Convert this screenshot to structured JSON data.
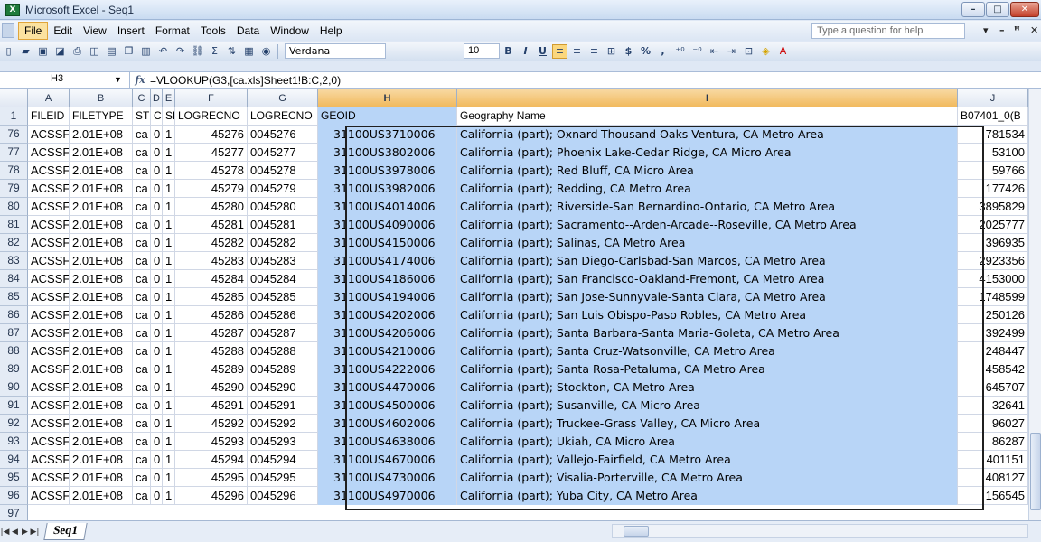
{
  "window": {
    "title": "Microsoft Excel - Seq1",
    "app_icon": "X"
  },
  "window_controls": {
    "minimize": "–",
    "maximize": "□",
    "close": "✕"
  },
  "menu": {
    "items": [
      "File",
      "Edit",
      "View",
      "Insert",
      "Format",
      "Tools",
      "Data",
      "Window",
      "Help"
    ],
    "help_placeholder": "Type a question for help",
    "right_controls": [
      "▾",
      "–",
      "ꟸ",
      "✕"
    ]
  },
  "toolbar": {
    "font_name": "Verdana",
    "font_size": "10",
    "bold": "B",
    "italic": "I",
    "underline": "U",
    "currency": "$",
    "percent": "%",
    "comma": ","
  },
  "formula_bar": {
    "name_box": "H3",
    "fx": "fx",
    "formula": "=VLOOKUP(G3,[ca.xls]Sheet1!B:C,2,0)"
  },
  "columns": [
    "A",
    "B",
    "C",
    "D",
    "E",
    "F",
    "G",
    "H",
    "I",
    "J"
  ],
  "header_row": {
    "row_number": "1",
    "cells": [
      "FILEID",
      "FILETYPE",
      "STU",
      "CI",
      "SE",
      "LOGRECNO",
      "LOGRECNO",
      "GEOID",
      "Geography Name",
      "B07401_0(B"
    ]
  },
  "rows": [
    {
      "n": "76",
      "cells": [
        "ACSSF",
        "2.01E+08",
        "ca",
        "0",
        "1",
        "45276",
        "0045276",
        "31100US3710006",
        "California (part); Oxnard-Thousand Oaks-Ventura, CA Metro Area",
        "781534"
      ]
    },
    {
      "n": "77",
      "cells": [
        "ACSSF",
        "2.01E+08",
        "ca",
        "0",
        "1",
        "45277",
        "0045277",
        "31100US3802006",
        "California (part); Phoenix Lake-Cedar Ridge, CA Micro Area",
        "53100"
      ]
    },
    {
      "n": "78",
      "cells": [
        "ACSSF",
        "2.01E+08",
        "ca",
        "0",
        "1",
        "45278",
        "0045278",
        "31100US3978006",
        "California (part); Red Bluff, CA Micro Area",
        "59766"
      ]
    },
    {
      "n": "79",
      "cells": [
        "ACSSF",
        "2.01E+08",
        "ca",
        "0",
        "1",
        "45279",
        "0045279",
        "31100US3982006",
        "California (part); Redding, CA Metro Area",
        "177426"
      ]
    },
    {
      "n": "80",
      "cells": [
        "ACSSF",
        "2.01E+08",
        "ca",
        "0",
        "1",
        "45280",
        "0045280",
        "31100US4014006",
        "California (part); Riverside-San Bernardino-Ontario, CA Metro Area",
        "3895829"
      ]
    },
    {
      "n": "81",
      "cells": [
        "ACSSF",
        "2.01E+08",
        "ca",
        "0",
        "1",
        "45281",
        "0045281",
        "31100US4090006",
        "California (part); Sacramento--Arden-Arcade--Roseville, CA Metro Area",
        "2025777"
      ]
    },
    {
      "n": "82",
      "cells": [
        "ACSSF",
        "2.01E+08",
        "ca",
        "0",
        "1",
        "45282",
        "0045282",
        "31100US4150006",
        "California (part); Salinas, CA Metro Area",
        "396935"
      ]
    },
    {
      "n": "83",
      "cells": [
        "ACSSF",
        "2.01E+08",
        "ca",
        "0",
        "1",
        "45283",
        "0045283",
        "31100US4174006",
        "California (part); San Diego-Carlsbad-San Marcos, CA Metro Area",
        "2923356"
      ]
    },
    {
      "n": "84",
      "cells": [
        "ACSSF",
        "2.01E+08",
        "ca",
        "0",
        "1",
        "45284",
        "0045284",
        "31100US4186006",
        "California (part); San Francisco-Oakland-Fremont, CA Metro Area",
        "4153000"
      ]
    },
    {
      "n": "85",
      "cells": [
        "ACSSF",
        "2.01E+08",
        "ca",
        "0",
        "1",
        "45285",
        "0045285",
        "31100US4194006",
        "California (part); San Jose-Sunnyvale-Santa Clara, CA Metro Area",
        "1748599"
      ]
    },
    {
      "n": "86",
      "cells": [
        "ACSSF",
        "2.01E+08",
        "ca",
        "0",
        "1",
        "45286",
        "0045286",
        "31100US4202006",
        "California (part); San Luis Obispo-Paso Robles, CA Metro Area",
        "250126"
      ]
    },
    {
      "n": "87",
      "cells": [
        "ACSSF",
        "2.01E+08",
        "ca",
        "0",
        "1",
        "45287",
        "0045287",
        "31100US4206006",
        "California (part); Santa Barbara-Santa Maria-Goleta, CA Metro Area",
        "392499"
      ]
    },
    {
      "n": "88",
      "cells": [
        "ACSSF",
        "2.01E+08",
        "ca",
        "0",
        "1",
        "45288",
        "0045288",
        "31100US4210006",
        "California (part); Santa Cruz-Watsonville, CA Metro Area",
        "248447"
      ]
    },
    {
      "n": "89",
      "cells": [
        "ACSSF",
        "2.01E+08",
        "ca",
        "0",
        "1",
        "45289",
        "0045289",
        "31100US4222006",
        "California (part); Santa Rosa-Petaluma, CA Metro Area",
        "458542"
      ]
    },
    {
      "n": "90",
      "cells": [
        "ACSSF",
        "2.01E+08",
        "ca",
        "0",
        "1",
        "45290",
        "0045290",
        "31100US4470006",
        "California (part); Stockton, CA Metro Area",
        "645707"
      ]
    },
    {
      "n": "91",
      "cells": [
        "ACSSF",
        "2.01E+08",
        "ca",
        "0",
        "1",
        "45291",
        "0045291",
        "31100US4500006",
        "California (part); Susanville, CA Micro Area",
        "32641"
      ]
    },
    {
      "n": "92",
      "cells": [
        "ACSSF",
        "2.01E+08",
        "ca",
        "0",
        "1",
        "45292",
        "0045292",
        "31100US4602006",
        "California (part); Truckee-Grass Valley, CA Micro Area",
        "96027"
      ]
    },
    {
      "n": "93",
      "cells": [
        "ACSSF",
        "2.01E+08",
        "ca",
        "0",
        "1",
        "45293",
        "0045293",
        "31100US4638006",
        "California (part); Ukiah, CA Micro Area",
        "86287"
      ]
    },
    {
      "n": "94",
      "cells": [
        "ACSSF",
        "2.01E+08",
        "ca",
        "0",
        "1",
        "45294",
        "0045294",
        "31100US4670006",
        "California (part); Vallejo-Fairfield, CA Metro Area",
        "401151"
      ]
    },
    {
      "n": "95",
      "cells": [
        "ACSSF",
        "2.01E+08",
        "ca",
        "0",
        "1",
        "45295",
        "0045295",
        "31100US4730006",
        "California (part); Visalia-Porterville, CA Metro Area",
        "408127"
      ]
    },
    {
      "n": "96",
      "cells": [
        "ACSSF",
        "2.01E+08",
        "ca",
        "0",
        "1",
        "45296",
        "0045296",
        "31100US4970006",
        "California (part); Yuba City, CA Metro Area",
        "156545"
      ]
    }
  ],
  "empty_row": "97",
  "sheet_tabs": [
    "Seq1"
  ],
  "colors": {
    "selection": "#b8d5f7",
    "selected_header": "#f1b85a",
    "brand": "#1e7a3b"
  }
}
